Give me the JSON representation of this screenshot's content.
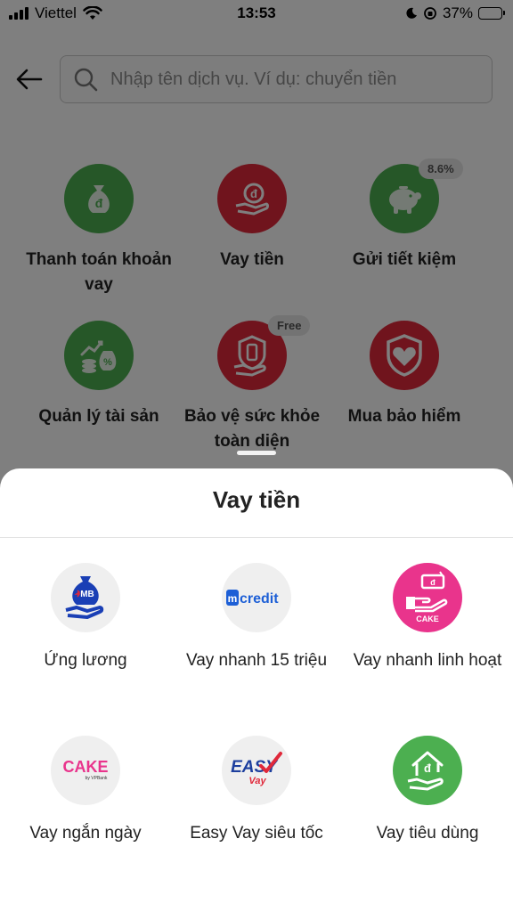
{
  "status_bar": {
    "carrier": "Viettel",
    "time": "13:53",
    "battery": "37%",
    "battery_level": 0.37
  },
  "search": {
    "placeholder": "Nhập tên dịch vụ. Ví dụ: chuyển tiền"
  },
  "services": [
    {
      "label": "Thanh toán khoản vay",
      "icon": "money-bag-icon",
      "color": "#4caf50"
    },
    {
      "label": "Vay tiền",
      "icon": "hand-coin-icon",
      "color": "#e0283a"
    },
    {
      "label": "Gửi tiết kiệm",
      "icon": "piggy-bank-icon",
      "color": "#4caf50",
      "tag": "8.6%"
    },
    {
      "label": "Quản lý tài sản",
      "icon": "asset-chart-icon",
      "color": "#4caf50"
    },
    {
      "label": "Bảo vệ sức khỏe toàn diện",
      "icon": "shield-phone-icon",
      "color": "#e0283a",
      "tag": "Free"
    },
    {
      "label": "Mua bảo hiểm",
      "icon": "heart-shield-icon",
      "color": "#e0283a"
    }
  ],
  "sheet": {
    "title": "Vay tiền",
    "options": [
      {
        "label": "Ứng lương",
        "icon": "mb-bag-icon"
      },
      {
        "label": "Vay nhanh 15 triệu",
        "icon": "mcredit-logo",
        "logo_text": "credit"
      },
      {
        "label": "Vay nhanh linh hoạt",
        "icon": "cake-hand-icon",
        "logo_text": "CAKE"
      },
      {
        "label": "Vay ngắn ngày",
        "icon": "cake-vpbank-logo",
        "logo_text": "CAKE",
        "logo_sub": "by VPBank"
      },
      {
        "label": "Easy Vay siêu tốc",
        "icon": "easy-vay-logo",
        "logo_text": "EASY",
        "logo_sub": "Vay"
      },
      {
        "label": "Vay tiêu dùng",
        "icon": "house-hand-icon"
      }
    ]
  },
  "colors": {
    "green": "#4caf50",
    "red": "#e0283a",
    "cake_pink": "#e9348c",
    "mb_blue": "#1a3fb5"
  }
}
